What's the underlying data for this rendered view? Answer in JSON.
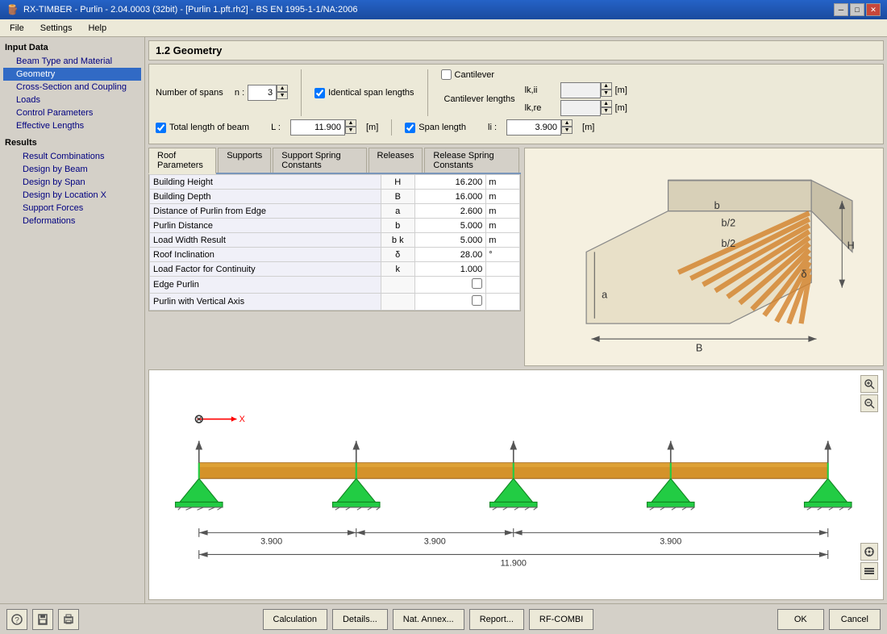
{
  "window": {
    "title": "RX-TIMBER - Purlin - 2.04.0003 (32bit) - [Purlin 1.pft.rh2] - BS EN 1995-1-1/NA:2006",
    "close_btn": "✕",
    "min_btn": "─",
    "max_btn": "□"
  },
  "menu": {
    "items": [
      "File",
      "Settings",
      "Help"
    ]
  },
  "sidebar": {
    "input_data_label": "Input Data",
    "items": [
      {
        "label": "Beam Type and Material",
        "active": false
      },
      {
        "label": "Geometry",
        "active": true
      },
      {
        "label": "Cross-Section and Coupling",
        "active": false
      },
      {
        "label": "Loads",
        "active": false
      },
      {
        "label": "Control Parameters",
        "active": false
      },
      {
        "label": "Effective Lengths",
        "active": false
      }
    ],
    "results_label": "Results",
    "result_items": [
      {
        "label": "Result Combinations",
        "active": false
      },
      {
        "label": "Design by Beam",
        "active": false
      },
      {
        "label": "Design by Span",
        "active": false
      },
      {
        "label": "Design by Location X",
        "active": false
      },
      {
        "label": "Support Forces",
        "active": false
      },
      {
        "label": "Deformations",
        "active": false
      }
    ]
  },
  "panel_title": "1.2 Geometry",
  "params": {
    "num_spans_label": "Number of spans",
    "n_label": "n :",
    "n_value": "3",
    "total_length_label": "Total length of beam",
    "L_label": "L :",
    "L_value": "11.900",
    "L_unit": "[m]",
    "identical_spans_label": "Identical span lengths",
    "identical_spans_checked": true,
    "span_length_label": "Span length",
    "li_label": "li :",
    "li_value": "3.900",
    "li_unit": "[m]",
    "cantilever_label": "Cantilever",
    "cantilever_checked": false,
    "cantilever_lengths_label": "Cantilever lengths",
    "lk_ii_label": "lk,ii",
    "lk_ii_value": "",
    "lk_ii_unit": "[m]",
    "lk_re_label": "lk,re",
    "lk_re_value": "",
    "lk_re_unit": "[m]"
  },
  "tabs": [
    "Roof Parameters",
    "Supports",
    "Support Spring Constants",
    "Releases",
    "Release Spring Constants"
  ],
  "active_tab": "Roof Parameters",
  "table_rows": [
    {
      "name": "Building Height",
      "sym": "H",
      "value": "16.200",
      "unit": "m"
    },
    {
      "name": "Building Depth",
      "sym": "B",
      "value": "16.000",
      "unit": "m"
    },
    {
      "name": "Distance of Purlin from Edge",
      "sym": "a",
      "value": "2.600",
      "unit": "m"
    },
    {
      "name": "Purlin Distance",
      "sym": "b",
      "value": "5.000",
      "unit": "m"
    },
    {
      "name": "Load Width Result",
      "sym": "b k",
      "value": "5.000",
      "unit": "m"
    },
    {
      "name": "Roof Inclination",
      "sym": "δ",
      "value": "28.00",
      "unit": "°"
    },
    {
      "name": "Load Factor for Continuity",
      "sym": "k",
      "value": "1.000",
      "unit": ""
    },
    {
      "name": "Edge Purlin",
      "sym": "",
      "value": "",
      "unit": "",
      "checkbox": true
    },
    {
      "name": "Purlin with Vertical Axis",
      "sym": "",
      "value": "",
      "unit": "",
      "checkbox": true
    }
  ],
  "buttons": {
    "calculation": "Calculation",
    "details": "Details...",
    "nat_annex": "Nat. Annex...",
    "report": "Report...",
    "rf_combi": "RF-COMBI",
    "ok": "OK",
    "cancel": "Cancel"
  },
  "diagram": {
    "spans": [
      "3.900",
      "3.900",
      "3.900"
    ],
    "total": "11.900"
  }
}
